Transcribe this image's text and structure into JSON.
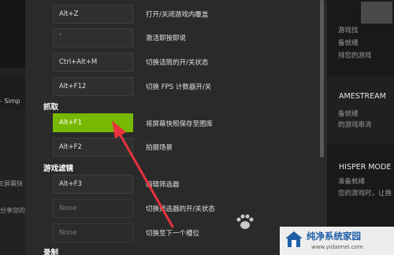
{
  "settings": {
    "top_row": {
      "key": "Alt+Z",
      "desc": "打开/关闭游戏内覆盖"
    },
    "rows_group1": [
      {
        "key": "`",
        "desc": "激活即按即说",
        "state": "normal"
      },
      {
        "key": "Ctrl+Alt+M",
        "desc": "切换话筒的开/关状态",
        "state": "normal"
      },
      {
        "key": "Alt+F12",
        "desc": "切换 FPS 计数器开/关",
        "state": "normal"
      }
    ],
    "section_capture": "抓取",
    "rows_capture": [
      {
        "key": "Alt+F1",
        "desc": "将屏幕快照保存至图库",
        "state": "active"
      },
      {
        "key": "Alt+F2",
        "desc": "拍摄场景",
        "state": "normal"
      }
    ],
    "section_filters": "游戏滤镜",
    "rows_filters": [
      {
        "key": "Alt+F3",
        "desc": "编辑筛选器",
        "state": "normal"
      },
      {
        "key": "None",
        "desc": "切换筛选器的开/关状态",
        "state": "placeholder"
      },
      {
        "key": "None",
        "desc": "切换至下一个槽位",
        "state": "placeholder"
      }
    ],
    "section_record": "录制"
  },
  "background_left": {
    "line1": "- Simp",
    "line2": "E屏幕快",
    "line3": "分享您的"
  },
  "background_right": {
    "line1": "游戏找",
    "line2": "备就绪",
    "line3": "排您的游戏",
    "line4": "AMESTREAM",
    "line5": "备就绪",
    "line6": "的游戏串流",
    "line7": "HISPER MODE",
    "line8": "准备就绪",
    "line9": "您的游戏时，让换"
  },
  "watermark": {
    "title": "纯净系统家园",
    "url": "www.yidaimei.com"
  },
  "colors": {
    "accent": "#76b900",
    "arrow": "#e8323c",
    "watermark_text": "#1f5fa8"
  }
}
